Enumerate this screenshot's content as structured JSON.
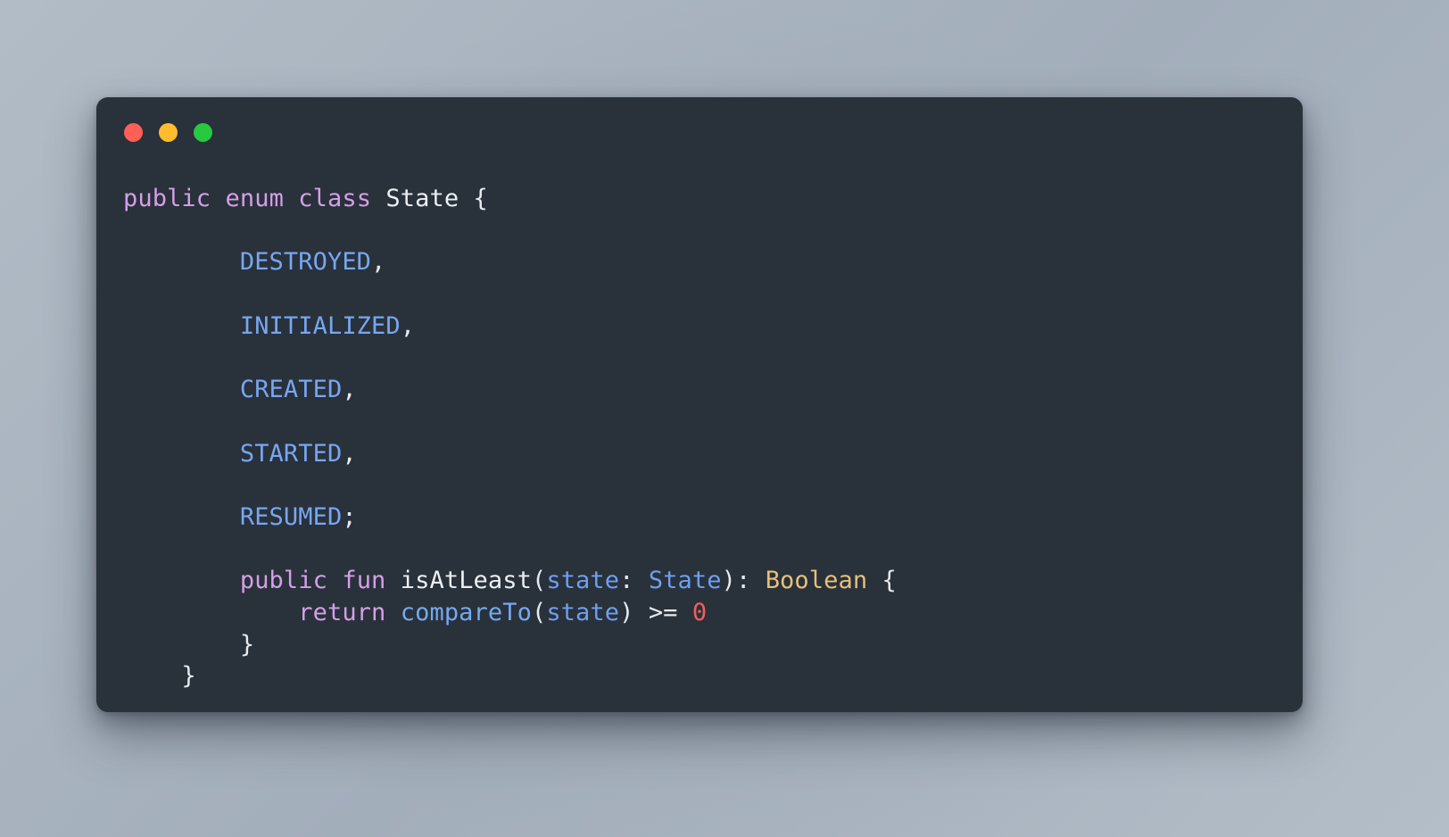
{
  "window": {
    "background_color": "#29313a",
    "traffic_lights": [
      {
        "name": "close",
        "color": "#ff5f56"
      },
      {
        "name": "minimize",
        "color": "#ffbd2e"
      },
      {
        "name": "maximize",
        "color": "#27c93f"
      }
    ]
  },
  "backdrop": {
    "gradient_from": "#b2bcc6",
    "gradient_to": "#b4bec8"
  },
  "theme": {
    "keyword_color": "#d49fe8",
    "identifier_color": "#eceff4",
    "enum_entry_color": "#77a7f2",
    "function_color": "#74a9f0",
    "type_color": "#6f9ff0",
    "return_type_color": "#e5c07b",
    "number_color": "#ef5f5f",
    "punctuation_color": "#e6e9ed"
  },
  "code": {
    "language": "kotlin",
    "lines": [
      {
        "indent": "",
        "tokens": [
          {
            "t": "public",
            "c": "kw"
          },
          {
            "t": " ",
            "c": "pun"
          },
          {
            "t": "enum",
            "c": "kw"
          },
          {
            "t": " ",
            "c": "pun"
          },
          {
            "t": "class",
            "c": "kw"
          },
          {
            "t": " ",
            "c": "pun"
          },
          {
            "t": "State",
            "c": "id"
          },
          {
            "t": " {",
            "c": "pun"
          }
        ]
      },
      {
        "indent": "",
        "tokens": []
      },
      {
        "indent": "        ",
        "tokens": [
          {
            "t": "DESTROYED",
            "c": "ent"
          },
          {
            "t": ",",
            "c": "pun"
          }
        ]
      },
      {
        "indent": "",
        "tokens": []
      },
      {
        "indent": "        ",
        "tokens": [
          {
            "t": "INITIALIZED",
            "c": "ent"
          },
          {
            "t": ",",
            "c": "pun"
          }
        ]
      },
      {
        "indent": "",
        "tokens": []
      },
      {
        "indent": "        ",
        "tokens": [
          {
            "t": "CREATED",
            "c": "ent"
          },
          {
            "t": ",",
            "c": "pun"
          }
        ]
      },
      {
        "indent": "",
        "tokens": []
      },
      {
        "indent": "        ",
        "tokens": [
          {
            "t": "STARTED",
            "c": "ent"
          },
          {
            "t": ",",
            "c": "pun"
          }
        ]
      },
      {
        "indent": "",
        "tokens": []
      },
      {
        "indent": "        ",
        "tokens": [
          {
            "t": "RESUMED",
            "c": "ent"
          },
          {
            "t": ";",
            "c": "pun"
          }
        ]
      },
      {
        "indent": "",
        "tokens": []
      },
      {
        "indent": "        ",
        "tokens": [
          {
            "t": "public",
            "c": "kw"
          },
          {
            "t": " ",
            "c": "pun"
          },
          {
            "t": "fun",
            "c": "kw"
          },
          {
            "t": " ",
            "c": "pun"
          },
          {
            "t": "isAtLeast",
            "c": "id"
          },
          {
            "t": "(",
            "c": "pun"
          },
          {
            "t": "state",
            "c": "type"
          },
          {
            "t": ": ",
            "c": "pun"
          },
          {
            "t": "State",
            "c": "type"
          },
          {
            "t": "): ",
            "c": "pun"
          },
          {
            "t": "Boolean",
            "c": "ret"
          },
          {
            "t": " {",
            "c": "pun"
          }
        ]
      },
      {
        "indent": "            ",
        "tokens": [
          {
            "t": "return",
            "c": "kw"
          },
          {
            "t": " ",
            "c": "pun"
          },
          {
            "t": "compareTo",
            "c": "fn"
          },
          {
            "t": "(",
            "c": "pun"
          },
          {
            "t": "state",
            "c": "type"
          },
          {
            "t": ") >= ",
            "c": "pun"
          },
          {
            "t": "0",
            "c": "num"
          }
        ]
      },
      {
        "indent": "        ",
        "tokens": [
          {
            "t": "}",
            "c": "pun"
          }
        ]
      },
      {
        "indent": "    ",
        "tokens": [
          {
            "t": "}",
            "c": "pun"
          }
        ]
      }
    ]
  }
}
